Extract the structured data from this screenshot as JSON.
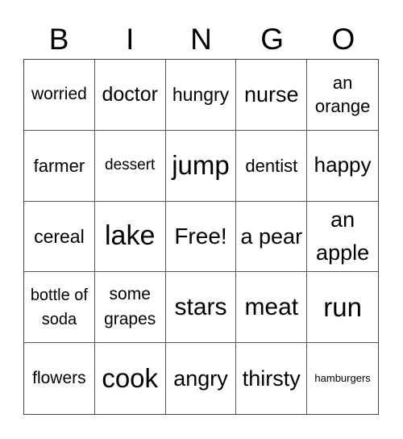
{
  "header": {
    "letters": [
      "B",
      "I",
      "N",
      "G",
      "O"
    ]
  },
  "grid": {
    "rows": [
      [
        "worried",
        "doctor",
        "hungry",
        "nurse",
        "an orange"
      ],
      [
        "farmer",
        "dessert",
        "jump",
        "dentist",
        "happy"
      ],
      [
        "cereal",
        "lake",
        "Free!",
        "a pear",
        "an apple"
      ],
      [
        "bottle of soda",
        "some grapes",
        "stars",
        "meat",
        "run"
      ],
      [
        "flowers",
        "cook",
        "angry",
        "thirsty",
        "hamburgers"
      ]
    ]
  }
}
